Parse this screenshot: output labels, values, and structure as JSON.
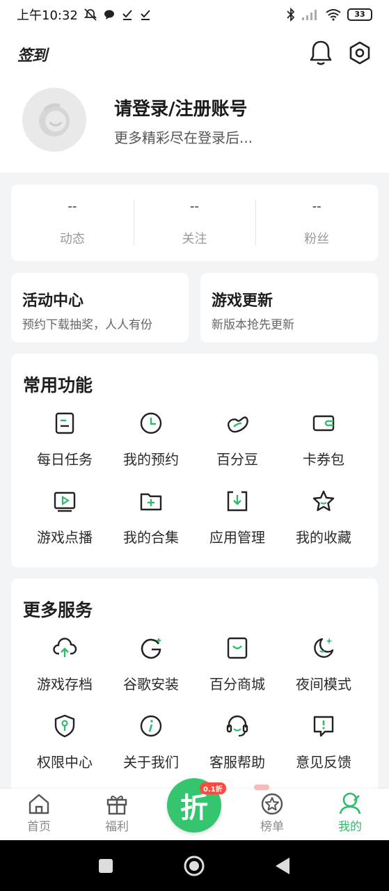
{
  "status_bar": {
    "time": "上午10:32",
    "battery": "33"
  },
  "header": {
    "signin_label": "签到",
    "login_title": "请登录/注册账号",
    "login_subtitle": "更多精彩尽在登录后..."
  },
  "stats": [
    {
      "value": "--",
      "label": "动态"
    },
    {
      "value": "--",
      "label": "关注"
    },
    {
      "value": "--",
      "label": "粉丝"
    }
  ],
  "promos": [
    {
      "title": "活动中心",
      "subtitle": "预约下载抽奖，人人有份"
    },
    {
      "title": "游戏更新",
      "subtitle": "新版本抢先更新"
    }
  ],
  "common": {
    "title": "常用功能",
    "items": [
      {
        "label": "每日任务",
        "icon": "task-icon"
      },
      {
        "label": "我的预约",
        "icon": "clock-icon"
      },
      {
        "label": "百分豆",
        "icon": "bean-icon"
      },
      {
        "label": "卡券包",
        "icon": "wallet-icon"
      },
      {
        "label": "游戏点播",
        "icon": "play-icon"
      },
      {
        "label": "我的合集",
        "icon": "folder-add-icon"
      },
      {
        "label": "应用管理",
        "icon": "download-box-icon"
      },
      {
        "label": "我的收藏",
        "icon": "star-icon"
      }
    ]
  },
  "more": {
    "title": "更多服务",
    "items": [
      {
        "label": "游戏存档",
        "icon": "cloud-upload-icon"
      },
      {
        "label": "谷歌安装",
        "icon": "google-icon"
      },
      {
        "label": "百分商城",
        "icon": "shop-bag-icon"
      },
      {
        "label": "夜间模式",
        "icon": "moon-icon"
      },
      {
        "label": "权限中心",
        "icon": "shield-key-icon"
      },
      {
        "label": "关于我们",
        "icon": "info-icon"
      },
      {
        "label": "客服帮助",
        "icon": "headset-icon"
      },
      {
        "label": "意见反馈",
        "icon": "feedback-icon"
      }
    ]
  },
  "bottom_nav": {
    "home": "首页",
    "welfare": "福利",
    "center": "折",
    "center_badge": "0.1折",
    "rank": "榜单",
    "mine": "我的"
  },
  "colors": {
    "accent": "#2ebb6a",
    "background": "#f3f4f6"
  }
}
